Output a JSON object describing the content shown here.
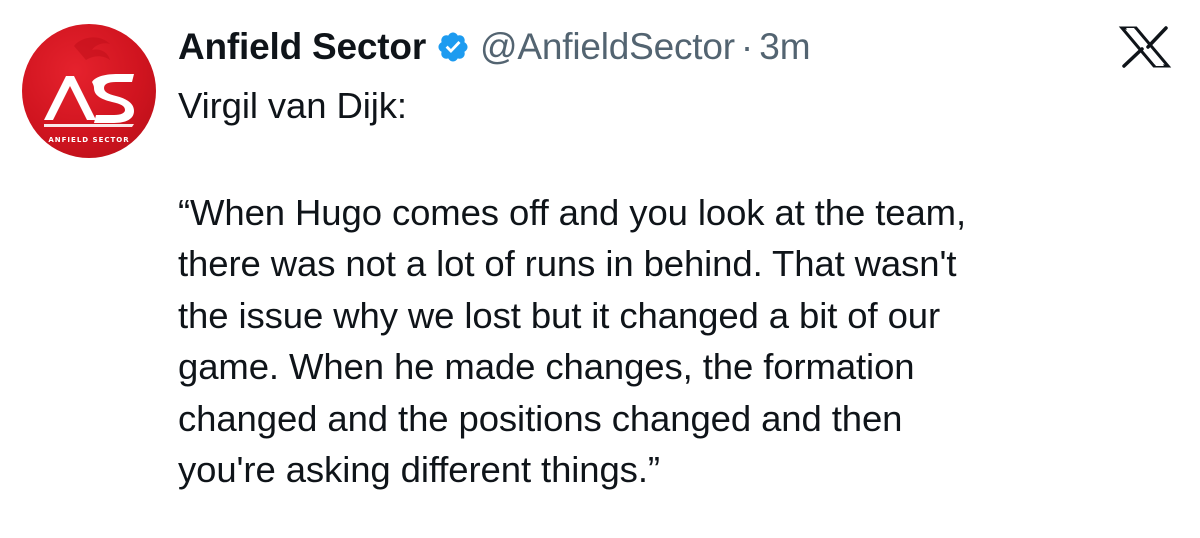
{
  "tweet": {
    "avatar_text": "AS",
    "avatar_subtext": "ANFIELD SECTOR",
    "display_name": "Anfield Sector",
    "handle": "@AnfieldSector",
    "separator": "·",
    "time": "3m",
    "verified": true,
    "platform_icon": "x-logo-icon",
    "text_line_1": "Virgil van Dijk:",
    "quote_lines": [
      "“When Hugo comes off and you look at the team,",
      "there was not a lot of runs in behind. That wasn't",
      "the issue why we lost but it changed a bit of our",
      "game. When he made changes, the formation",
      "changed and the positions changed and then",
      "you're asking different things.”"
    ]
  },
  "colors": {
    "text": "#0f1419",
    "secondary_text": "#536471",
    "verified_blue": "#1d9bf0",
    "avatar_red": "#d0141f"
  }
}
